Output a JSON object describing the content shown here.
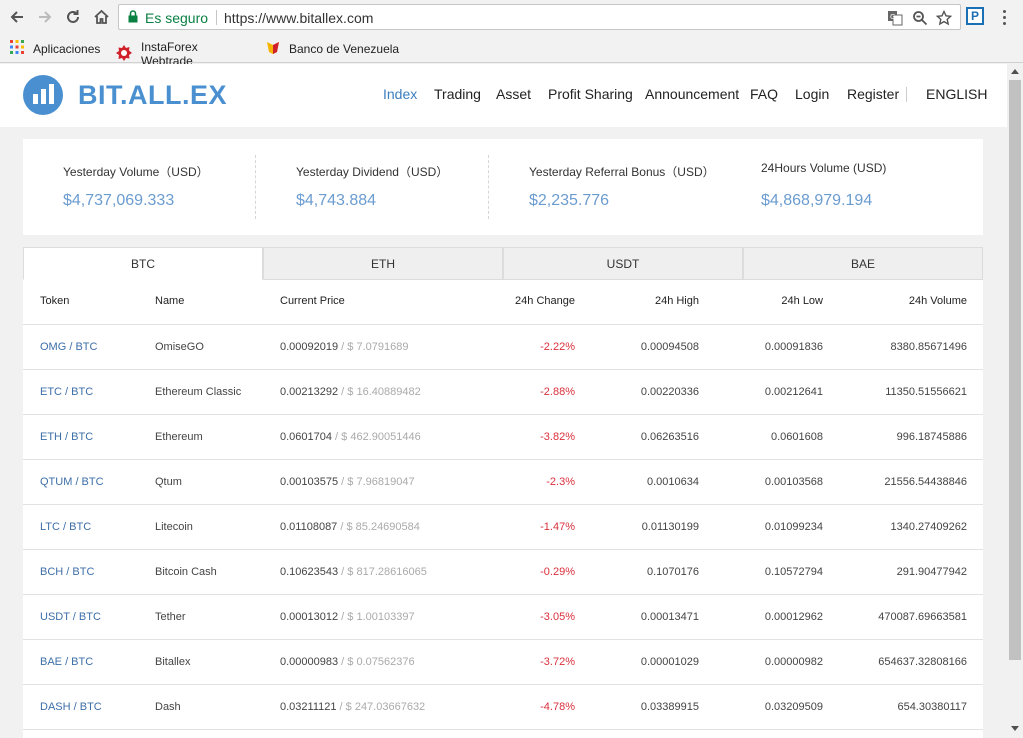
{
  "browser": {
    "secure_label": "Es seguro",
    "url": "https://www.bitallex.com",
    "extension_letter": "P",
    "bookmarks": [
      {
        "label": "Aplicaciones",
        "icon": "apps-grid-icon"
      },
      {
        "label": "InstaForex Webtrade",
        "icon": "instaforex-icon"
      },
      {
        "label": "Banco de Venezuela",
        "icon": "banco-venezuela-icon"
      }
    ]
  },
  "site": {
    "logo_text": "BIT.ALL.EX",
    "nav": [
      {
        "label": "Index",
        "active": true
      },
      {
        "label": "Trading"
      },
      {
        "label": "Asset"
      },
      {
        "label": "Profit Sharing"
      },
      {
        "label": "Announcement"
      },
      {
        "label": "FAQ"
      },
      {
        "label": "Login"
      },
      {
        "label": "Register"
      }
    ],
    "language": "ENGLISH"
  },
  "stats": [
    {
      "label": "Yesterday Volume（USD）",
      "value": "$4,737,069.333"
    },
    {
      "label": "Yesterday Dividend（USD）",
      "value": "$4,743.884"
    },
    {
      "label": "Yesterday Referral Bonus（USD）",
      "value": "$2,235.776"
    },
    {
      "label": "24Hours Volume (USD)",
      "value": "$4,868,979.194"
    }
  ],
  "market": {
    "tabs": [
      {
        "label": "BTC",
        "active": true
      },
      {
        "label": "ETH"
      },
      {
        "label": "USDT"
      },
      {
        "label": "BAE"
      }
    ],
    "columns": {
      "token": "Token",
      "name": "Name",
      "price": "Current Price",
      "change": "24h Change",
      "high": "24h High",
      "low": "24h Low",
      "volume": "24h Volume"
    },
    "rows": [
      {
        "token": "OMG / BTC",
        "name": "OmiseGO",
        "price": "0.00092019",
        "usd": " / $ 7.0791689",
        "change": "-2.22%",
        "high": "0.00094508",
        "low": "0.00091836",
        "volume": "8380.85671496"
      },
      {
        "token": "ETC / BTC",
        "name": "Ethereum Classic",
        "price": "0.00213292",
        "usd": " / $ 16.40889482",
        "change": "-2.88%",
        "high": "0.00220336",
        "low": "0.00212641",
        "volume": "11350.51556621"
      },
      {
        "token": "ETH / BTC",
        "name": "Ethereum",
        "price": "0.0601704",
        "usd": " / $ 462.90051446",
        "change": "-3.82%",
        "high": "0.06263516",
        "low": "0.0601608",
        "volume": "996.18745886"
      },
      {
        "token": "QTUM / BTC",
        "name": "Qtum",
        "price": "0.00103575",
        "usd": " / $ 7.96819047",
        "change": "-2.3%",
        "high": "0.0010634",
        "low": "0.00103568",
        "volume": "21556.54438846"
      },
      {
        "token": "LTC / BTC",
        "name": "Litecoin",
        "price": "0.01108087",
        "usd": " / $ 85.24690584",
        "change": "-1.47%",
        "high": "0.01130199",
        "low": "0.01099234",
        "volume": "1340.27409262"
      },
      {
        "token": "BCH / BTC",
        "name": "Bitcoin Cash",
        "price": "0.10623543",
        "usd": " / $ 817.28616065",
        "change": "-0.29%",
        "high": "0.1070176",
        "low": "0.10572794",
        "volume": "291.90477942"
      },
      {
        "token": "USDT / BTC",
        "name": "Tether",
        "price": "0.00013012",
        "usd": " / $ 1.00103397",
        "change": "-3.05%",
        "high": "0.00013471",
        "low": "0.00012962",
        "volume": "470087.69663581"
      },
      {
        "token": "BAE / BTC",
        "name": "Bitallex",
        "price": "0.00000983",
        "usd": " / $ 0.07562376",
        "change": "-3.72%",
        "high": "0.00001029",
        "low": "0.00000982",
        "volume": "654637.32808166"
      },
      {
        "token": "DASH / BTC",
        "name": "Dash",
        "price": "0.03211121",
        "usd": " / $ 247.03667632",
        "change": "-4.78%",
        "high": "0.03389915",
        "low": "0.03209509",
        "volume": "654.30380117"
      }
    ]
  }
}
